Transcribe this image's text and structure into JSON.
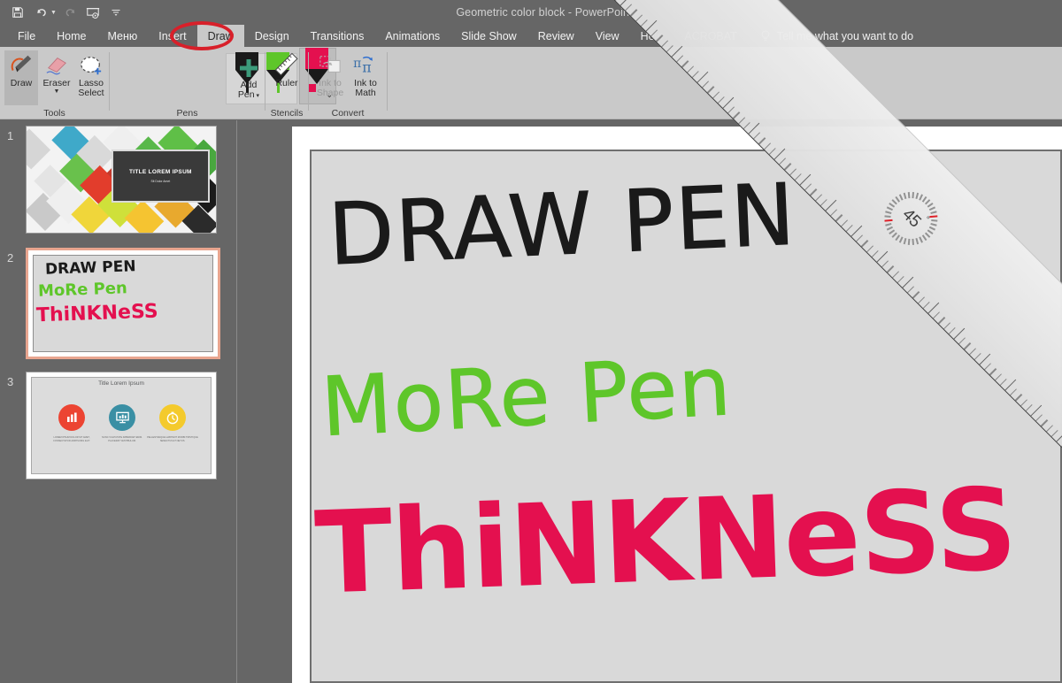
{
  "window": {
    "title": "Geometric color block  -  PowerPoint"
  },
  "quick_access": [
    {
      "name": "save-icon",
      "label": "Save",
      "glyph": "💾",
      "disabled": false
    },
    {
      "name": "undo-icon",
      "label": "Undo",
      "glyph": "↶",
      "disabled": false,
      "dropdown": true
    },
    {
      "name": "redo-icon",
      "label": "Redo",
      "glyph": "↻",
      "disabled": true
    },
    {
      "name": "start-slideshow-icon",
      "label": "Start From Beginning",
      "glyph": "⮞",
      "disabled": false
    },
    {
      "name": "customize-qat-icon",
      "label": "Customize Quick Access Toolbar",
      "glyph": "≡",
      "disabled": false
    }
  ],
  "tabs": [
    {
      "label": "File",
      "active": false
    },
    {
      "label": "Home",
      "active": false
    },
    {
      "label": "Меню",
      "active": false
    },
    {
      "label": "Insert",
      "active": false
    },
    {
      "label": "Draw",
      "active": true
    },
    {
      "label": "Design",
      "active": false
    },
    {
      "label": "Transitions",
      "active": false
    },
    {
      "label": "Animations",
      "active": false
    },
    {
      "label": "Slide Show",
      "active": false
    },
    {
      "label": "Review",
      "active": false
    },
    {
      "label": "View",
      "active": false
    },
    {
      "label": "Help",
      "active": false
    },
    {
      "label": "ACROBAT",
      "active": false
    }
  ],
  "tell_me": {
    "placeholder": "Tell me what you want to do",
    "icon": "lightbulb-icon"
  },
  "annotation": {
    "shape": "ellipse",
    "color": "#d8202a",
    "targets": "Draw"
  },
  "ribbon": {
    "groups": [
      {
        "name": "tools",
        "label": "Tools",
        "items": [
          {
            "label": "Draw",
            "selected": true,
            "disabled": false,
            "icon": "pen-draw-icon"
          },
          {
            "label": "Eraser",
            "selected": false,
            "disabled": false,
            "icon": "eraser-icon",
            "dropdown": true
          },
          {
            "label": "Lasso\nSelect",
            "line1": "Lasso",
            "line2": "Select",
            "selected": false,
            "disabled": false,
            "icon": "lasso-select-icon"
          }
        ]
      },
      {
        "name": "pens",
        "label": "Pens",
        "pens": [
          {
            "name": "pen-black",
            "color": "#1a1a1a",
            "selected": false
          },
          {
            "name": "pen-green",
            "color": "#5ec62a",
            "selected": false
          },
          {
            "name": "pen-pink-highlighter",
            "color": "#e4104f",
            "selected": true
          }
        ],
        "add_pen": {
          "label_line1": "Add",
          "label_line2": "Pen",
          "icon": "plus-icon",
          "dropdown": true
        }
      },
      {
        "name": "stencils",
        "label": "Stencils",
        "items": [
          {
            "label": "Ruler",
            "selected": false,
            "disabled": false,
            "icon": "ruler-icon"
          }
        ]
      },
      {
        "name": "convert",
        "label": "Convert",
        "items": [
          {
            "line1": "Ink to",
            "line2": "Shape",
            "disabled": true,
            "icon": "ink-to-shape-icon"
          },
          {
            "line1": "Ink to",
            "line2": "Math",
            "disabled": false,
            "icon": "ink-to-math-icon"
          }
        ]
      }
    ]
  },
  "slides": [
    {
      "number": "1",
      "current": false,
      "type": "title-slide",
      "title": "TITLE LOREM IPSUM",
      "subtitle": "Sit Dolor Amet"
    },
    {
      "number": "2",
      "current": true,
      "type": "ink-slide",
      "ink": [
        {
          "text": "DRAW PEN",
          "color": "#1a1a1a"
        },
        {
          "text": "MoRe Pen",
          "color": "#5ec62a"
        },
        {
          "text": "ThiNKNeSS",
          "color": "#e4104f"
        }
      ]
    },
    {
      "number": "3",
      "current": false,
      "type": "three-icons-slide",
      "title": "Title Lorem Ipsum",
      "icons": [
        {
          "name": "bar-chart-icon",
          "color": "#ec4432",
          "glyph": "█"
        },
        {
          "name": "presentation-chart-icon",
          "color": "#3a8fa4",
          "glyph": "▦"
        },
        {
          "name": "stopwatch-icon",
          "color": "#f4ca2c",
          "glyph": "⏱"
        }
      ],
      "captions": [
        "LOREM IPSUM DOLOR SIT AMET, CONSECTETUR ADIPISCING ELIT.",
        "NUNC VULPUTATE IMPERDIET ENIM. PLACERAT VESTIBULUM.",
        "PELLENTESQUE HABITANT MORBI TRISTIQUE SENECTUS ET NETUS."
      ]
    }
  ],
  "canvas": {
    "ink_strokes": [
      {
        "name": "ink-draw-pen",
        "text": "DRAW PEN",
        "color": "#1a1a1a",
        "style": "thin-pen"
      },
      {
        "name": "ink-more-pen",
        "text": "MoRe Pen",
        "color": "#5ec62a",
        "style": "thin-pen"
      },
      {
        "name": "ink-thinkness",
        "text": "ThiNKNeSS",
        "color": "#e4104f",
        "style": "thick-marker"
      }
    ]
  },
  "ruler_tool": {
    "name": "ruler-overlay",
    "angle_value": "45",
    "degree_symbol": "°",
    "rotation_deg": 45
  }
}
